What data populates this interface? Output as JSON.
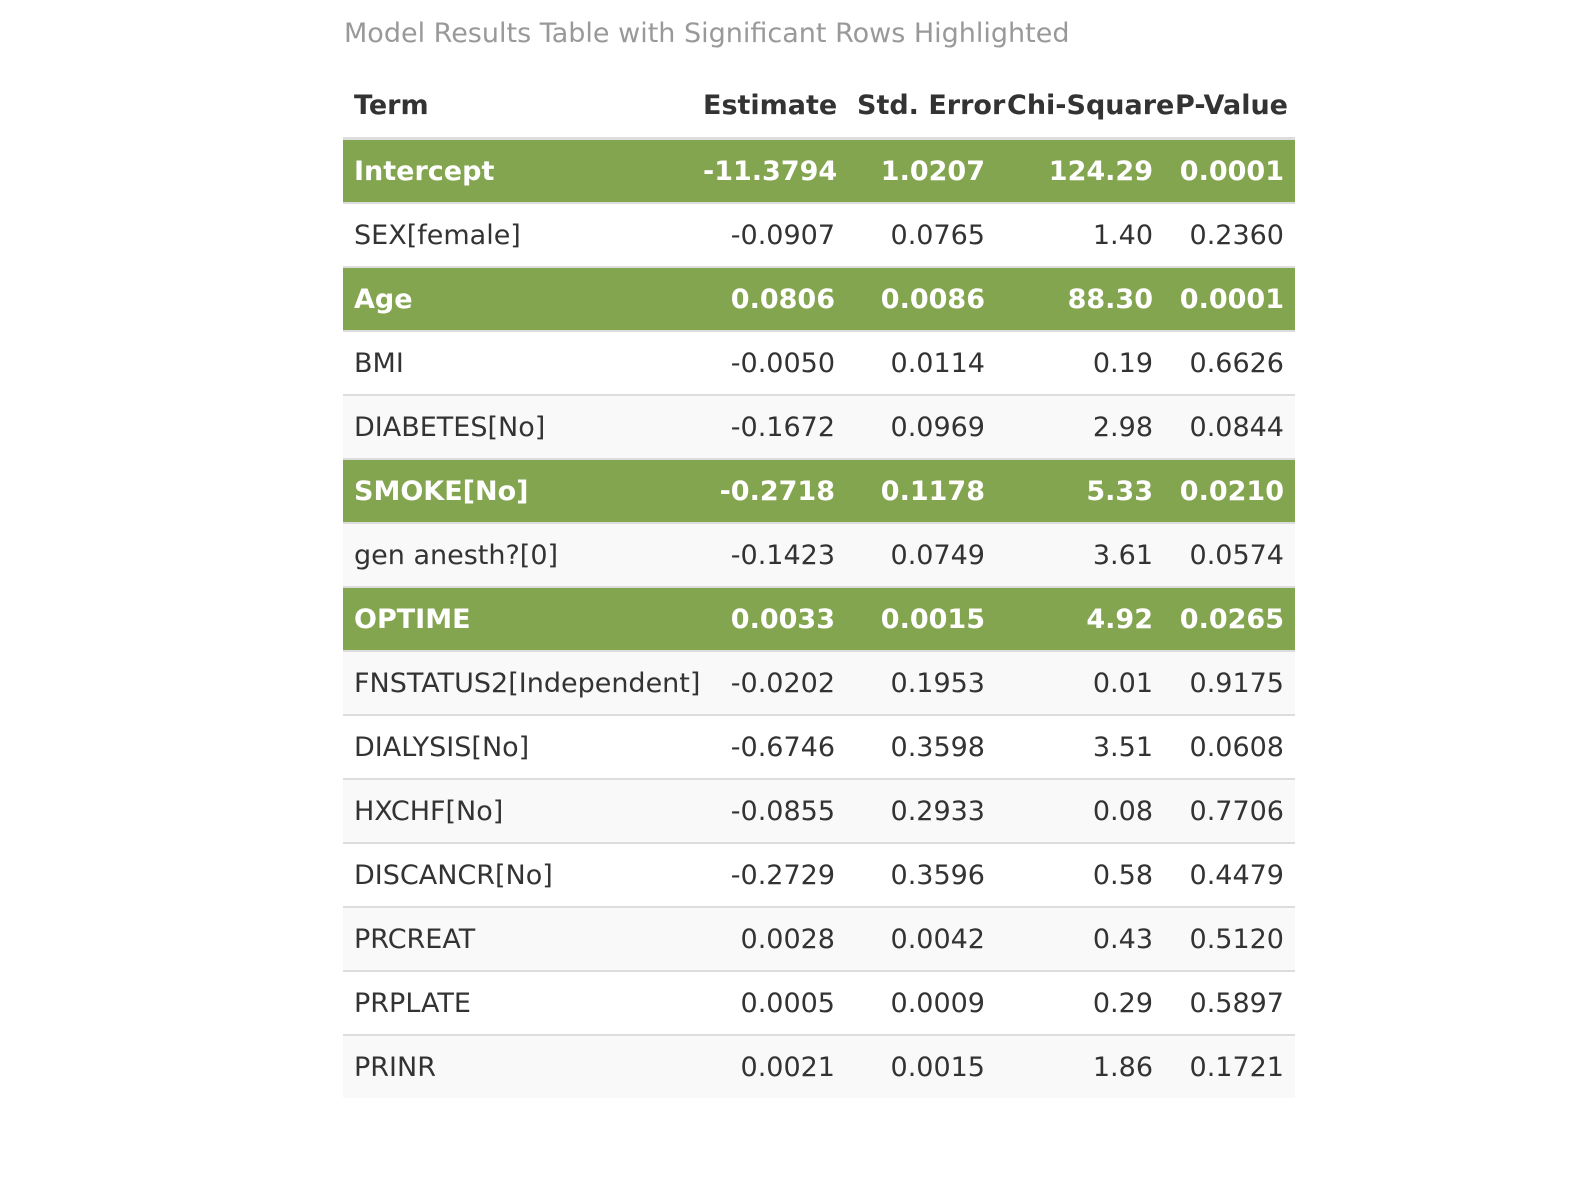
{
  "chart_data": {
    "type": "table",
    "title": "Model Results Table with Significant Rows Highlighted",
    "columns": [
      "Term",
      "Estimate",
      "Std. Error",
      "Chi-Square",
      "P-Value"
    ],
    "highlight_color": "#84a54f",
    "rows": [
      {
        "term": "Intercept",
        "estimate": "-11.3794",
        "std_error": "1.0207",
        "chi_square": "124.29",
        "p_value": "0.0001",
        "significant": true
      },
      {
        "term": "SEX[female]",
        "estimate": "-0.0907",
        "std_error": "0.0765",
        "chi_square": "1.40",
        "p_value": "0.2360",
        "significant": false
      },
      {
        "term": "Age",
        "estimate": "0.0806",
        "std_error": "0.0086",
        "chi_square": "88.30",
        "p_value": "0.0001",
        "significant": true
      },
      {
        "term": "BMI",
        "estimate": "-0.0050",
        "std_error": "0.0114",
        "chi_square": "0.19",
        "p_value": "0.6626",
        "significant": false
      },
      {
        "term": "DIABETES[No]",
        "estimate": "-0.1672",
        "std_error": "0.0969",
        "chi_square": "2.98",
        "p_value": "0.0844",
        "significant": false
      },
      {
        "term": "SMOKE[No]",
        "estimate": "-0.2718",
        "std_error": "0.1178",
        "chi_square": "5.33",
        "p_value": "0.0210",
        "significant": true
      },
      {
        "term": "gen anesth?[0]",
        "estimate": "-0.1423",
        "std_error": "0.0749",
        "chi_square": "3.61",
        "p_value": "0.0574",
        "significant": false
      },
      {
        "term": "OPTIME",
        "estimate": "0.0033",
        "std_error": "0.0015",
        "chi_square": "4.92",
        "p_value": "0.0265",
        "significant": true
      },
      {
        "term": "FNSTATUS2[Independent]",
        "estimate": "-0.0202",
        "std_error": "0.1953",
        "chi_square": "0.01",
        "p_value": "0.9175",
        "significant": false
      },
      {
        "term": "DIALYSIS[No]",
        "estimate": "-0.6746",
        "std_error": "0.3598",
        "chi_square": "3.51",
        "p_value": "0.0608",
        "significant": false
      },
      {
        "term": "HXCHF[No]",
        "estimate": "-0.0855",
        "std_error": "0.2933",
        "chi_square": "0.08",
        "p_value": "0.7706",
        "significant": false
      },
      {
        "term": "DISCANCR[No]",
        "estimate": "-0.2729",
        "std_error": "0.3596",
        "chi_square": "0.58",
        "p_value": "0.4479",
        "significant": false
      },
      {
        "term": "PRCREAT",
        "estimate": "0.0028",
        "std_error": "0.0042",
        "chi_square": "0.43",
        "p_value": "0.5120",
        "significant": false
      },
      {
        "term": "PRPLATE",
        "estimate": "0.0005",
        "std_error": "0.0009",
        "chi_square": "0.29",
        "p_value": "0.5897",
        "significant": false
      },
      {
        "term": "PRINR",
        "estimate": "0.0021",
        "std_error": "0.0015",
        "chi_square": "1.86",
        "p_value": "0.1721",
        "significant": false
      }
    ]
  }
}
